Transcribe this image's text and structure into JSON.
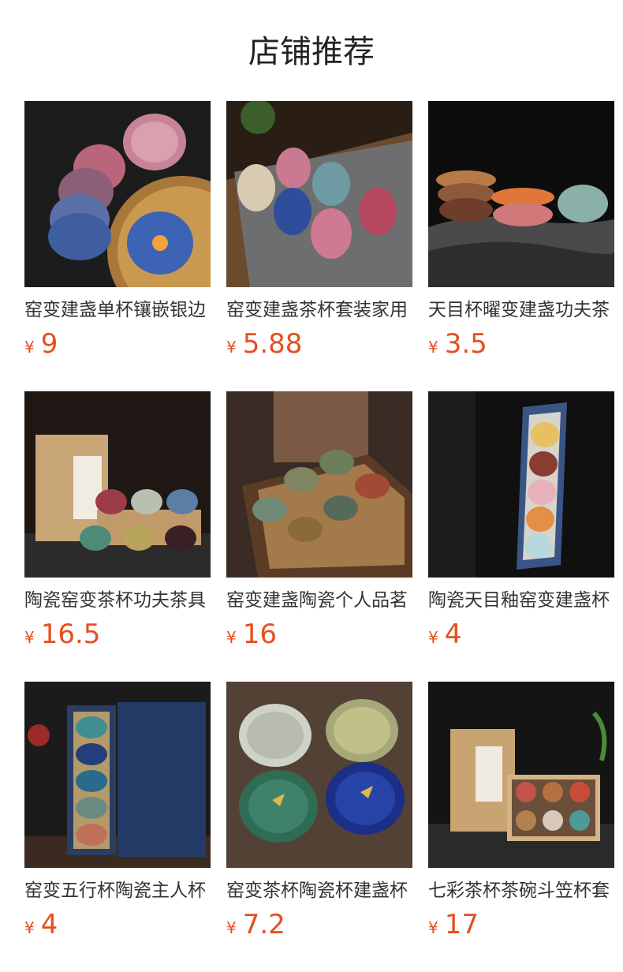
{
  "header": {
    "title": "店铺推荐"
  },
  "currency_symbol": "¥",
  "products": [
    {
      "name": "窑变建盏单杯镶嵌银边",
      "price": "9",
      "image": "pink-blue-cups-on-bamboo-tray"
    },
    {
      "name": "窑变建盏茶杯套装家用",
      "price": "5.88",
      "image": "six-colorful-cups-on-runner"
    },
    {
      "name": "天目杯曜变建盏功夫茶",
      "price": "3.5",
      "image": "stacked-cups-on-rock"
    },
    {
      "name": "陶瓷窑变茶杯功夫茶具",
      "price": "16.5",
      "image": "six-cups-with-gift-bag"
    },
    {
      "name": "窑变建盏陶瓷个人品茗",
      "price": "16",
      "image": "cups-on-wooden-tray"
    },
    {
      "name": "陶瓷天目釉窑变建盏杯",
      "price": "4",
      "image": "five-cups-in-long-box"
    },
    {
      "name": "窑变五行杯陶瓷主人杯",
      "price": "4",
      "image": "five-cups-blue-gift-box"
    },
    {
      "name": "窑变茶杯陶瓷杯建盏杯",
      "price": "7.2",
      "image": "ginkgo-gold-cups"
    },
    {
      "name": "七彩茶杯茶碗斗笠杯套",
      "price": "17",
      "image": "six-cups-in-kraft-box"
    }
  ]
}
